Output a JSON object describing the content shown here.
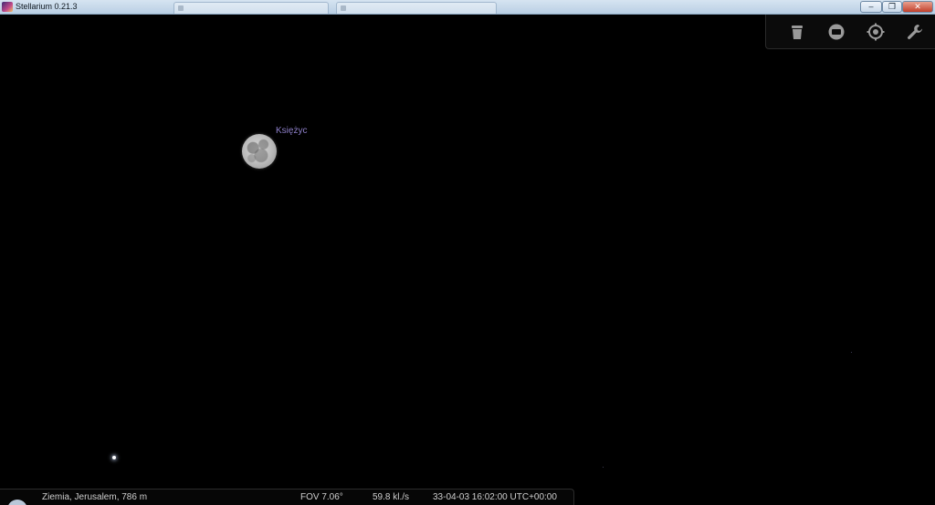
{
  "window": {
    "title": "Stellarium 0.21.3",
    "minimize_glyph": "–",
    "maximize_glyph": "❐",
    "close_glyph": "✕"
  },
  "toolbar": {
    "buttons": [
      {
        "name": "trash-icon"
      },
      {
        "name": "rectangle-toggle-icon"
      },
      {
        "name": "target-crosshair-icon"
      },
      {
        "name": "wrench-icon"
      }
    ]
  },
  "sky": {
    "moon_label": "Księżyc",
    "moon_label_color": "#8d7fc8"
  },
  "status": {
    "location": "Ziemia, Jerusalem, 786 m",
    "fov": "FOV 7.06°",
    "fps": "59.8 kl./s",
    "datetime": "33-04-03 16:02:00 UTC+00:00"
  }
}
